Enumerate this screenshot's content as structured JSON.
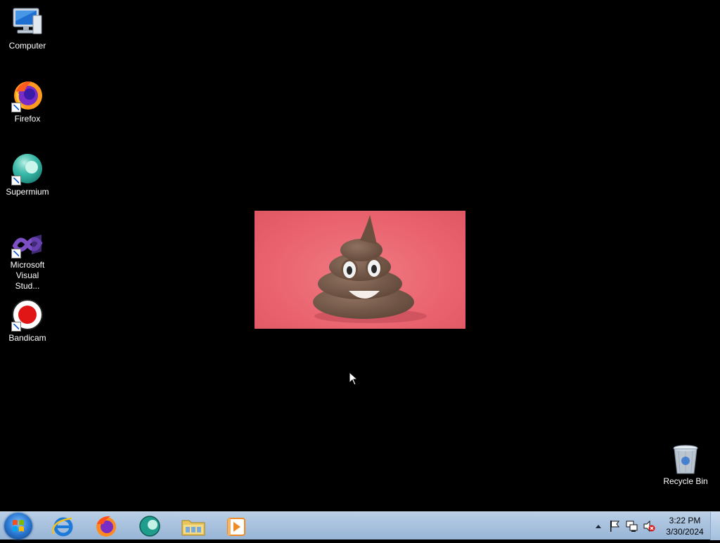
{
  "desktop": {
    "icons": [
      {
        "label": "Computer",
        "icon": "computer-icon"
      },
      {
        "label": "Firefox",
        "icon": "firefox-icon"
      },
      {
        "label": "Supermium",
        "icon": "supermium-icon"
      },
      {
        "label": "Microsoft Visual Stud...",
        "icon": "visual-studio-icon"
      },
      {
        "label": "Bandicam",
        "icon": "bandicam-icon"
      }
    ],
    "recycle_bin": {
      "label": "Recycle Bin",
      "icon": "recycle-bin-icon"
    },
    "photo": {
      "subject": "poop-emoji-clay-figure",
      "background": "#e8606c"
    }
  },
  "taskbar": {
    "start_icon": "windows-start-icon",
    "pinned": [
      {
        "icon": "internet-explorer-icon"
      },
      {
        "icon": "firefox-icon"
      },
      {
        "icon": "supermium-icon"
      },
      {
        "icon": "file-explorer-icon"
      },
      {
        "icon": "media-player-icon"
      }
    ],
    "tray": {
      "icons": [
        "show-hidden-icons-arrow",
        "action-center-flag-icon",
        "network-icon",
        "volume-muted-icon"
      ],
      "time": "3:22 PM",
      "date": "3/30/2024"
    }
  },
  "colors": {
    "taskbar": "#a9c2de",
    "desktop": "#000000"
  }
}
